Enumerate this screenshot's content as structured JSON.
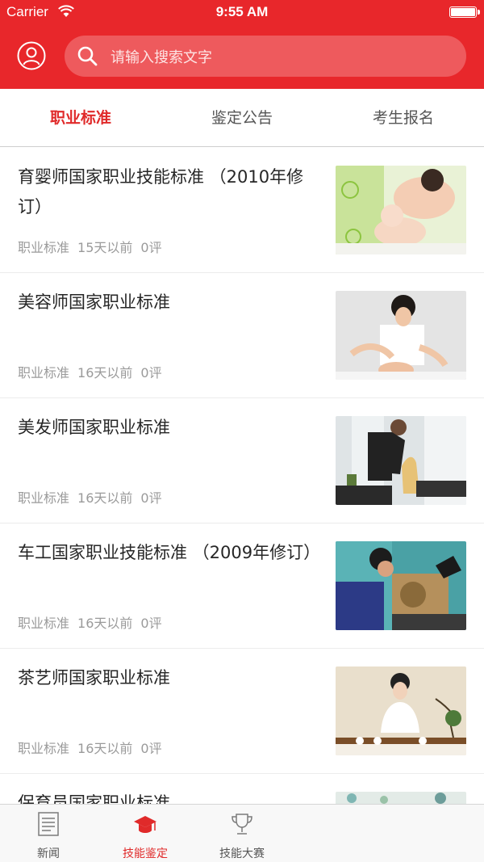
{
  "status_bar": {
    "carrier": "Carrier",
    "time": "9:55 AM"
  },
  "search": {
    "placeholder": "请输入搜索文字"
  },
  "tabs": [
    {
      "label": "职业标准",
      "active": true
    },
    {
      "label": "鉴定公告",
      "active": false
    },
    {
      "label": "考生报名",
      "active": false
    }
  ],
  "articles": [
    {
      "title": "育婴师国家职业技能标准 （2010年修订）",
      "category": "职业标准",
      "time": "15天以前",
      "comments": "0评",
      "image": "mother-baby-photo"
    },
    {
      "title": "美容师国家职业标准",
      "category": "职业标准",
      "time": "16天以前",
      "comments": "0评",
      "image": "beautician-photo"
    },
    {
      "title": "美发师国家职业标准",
      "category": "职业标准",
      "time": "16天以前",
      "comments": "0评",
      "image": "hairdresser-photo"
    },
    {
      "title": "车工国家职业技能标准 （2009年修订）",
      "category": "职业标准",
      "time": "16天以前",
      "comments": "0评",
      "image": "lathe-worker-photo"
    },
    {
      "title": "茶艺师国家职业标准",
      "category": "职业标准",
      "time": "16天以前",
      "comments": "0评",
      "image": "tea-ceremony-photo"
    },
    {
      "title": "保育员国家职业标准",
      "category": "",
      "time": "",
      "comments": "",
      "image": "partial-photo"
    }
  ],
  "tabbar": [
    {
      "label": "新闻",
      "icon": "newspaper-icon",
      "active": false
    },
    {
      "label": "技能鉴定",
      "icon": "graduation-cap-icon",
      "active": true
    },
    {
      "label": "技能大赛",
      "icon": "trophy-icon",
      "active": false
    }
  ],
  "colors": {
    "brand_red": "#e8272b",
    "active_tab": "#e02a2a"
  }
}
